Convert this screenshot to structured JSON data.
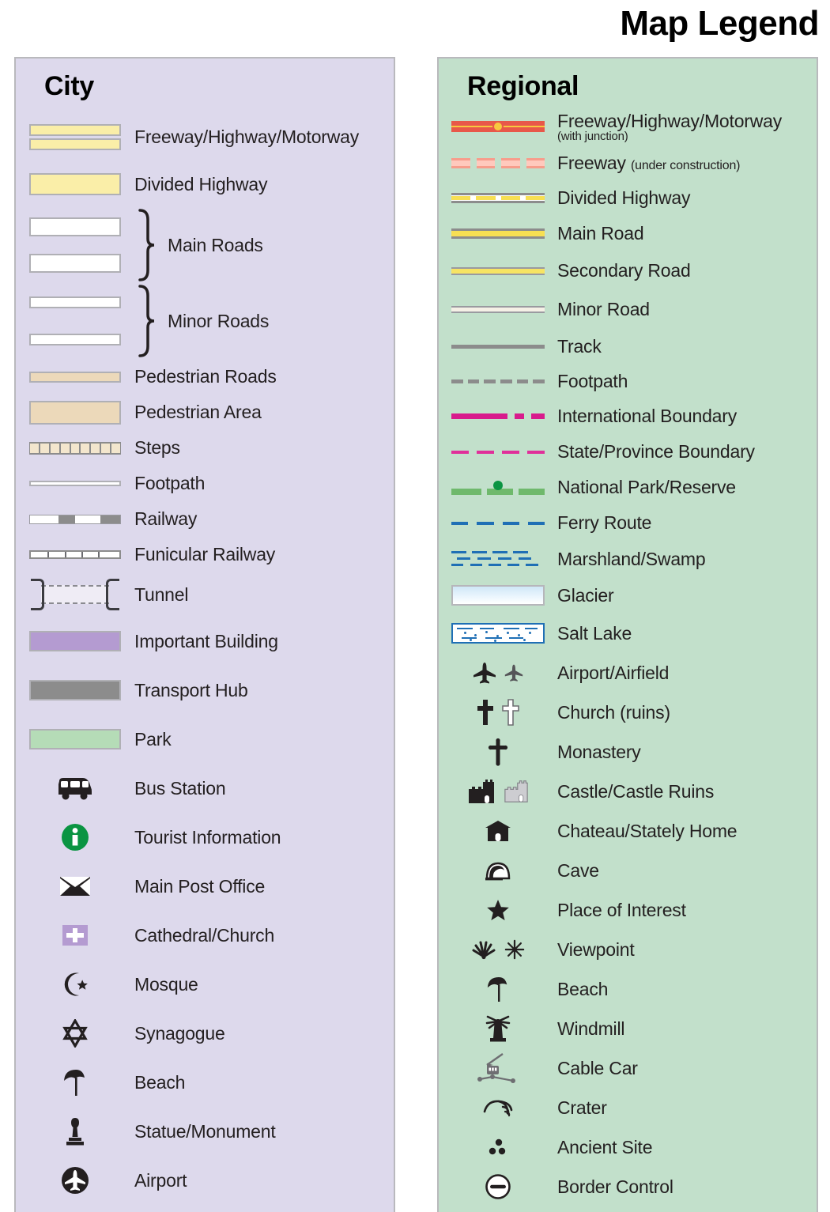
{
  "title": "Map Legend",
  "panels": {
    "city": {
      "heading": "City",
      "background_color": "#ddd9ec",
      "items": [
        {
          "label": "Freeway/Highway/Motorway",
          "symbol": "city-freeway-swatch"
        },
        {
          "label": "Divided Highway",
          "symbol": "city-divided-highway-swatch"
        },
        {
          "label": "Main Roads",
          "symbol": "city-main-roads-swatch"
        },
        {
          "label": "Minor Roads",
          "symbol": "city-minor-roads-swatch"
        },
        {
          "label": "Pedestrian Roads",
          "symbol": "city-pedestrian-road-swatch"
        },
        {
          "label": "Pedestrian Area",
          "symbol": "city-pedestrian-area-swatch"
        },
        {
          "label": "Steps",
          "symbol": "city-steps-swatch"
        },
        {
          "label": "Footpath",
          "symbol": "city-footpath-swatch"
        },
        {
          "label": "Railway",
          "symbol": "city-railway-swatch"
        },
        {
          "label": "Funicular Railway",
          "symbol": "city-funicular-swatch"
        },
        {
          "label": "Tunnel",
          "symbol": "city-tunnel-swatch"
        },
        {
          "label": "Important Building",
          "symbol": "city-important-building-swatch"
        },
        {
          "label": "Transport Hub",
          "symbol": "city-transport-hub-swatch"
        },
        {
          "label": "Park",
          "symbol": "city-park-swatch"
        },
        {
          "label": "Bus Station",
          "symbol": "bus-icon"
        },
        {
          "label": "Tourist Information",
          "symbol": "information-icon"
        },
        {
          "label": "Main Post Office",
          "symbol": "envelope-icon"
        },
        {
          "label": "Cathedral/Church",
          "symbol": "church-cross-square-icon"
        },
        {
          "label": "Mosque",
          "symbol": "star-and-crescent-icon"
        },
        {
          "label": "Synagogue",
          "symbol": "star-of-david-icon"
        },
        {
          "label": "Beach",
          "symbol": "beach-umbrella-icon"
        },
        {
          "label": "Statue/Monument",
          "symbol": "statue-icon"
        },
        {
          "label": "Airport",
          "symbol": "airplane-circle-icon"
        }
      ]
    },
    "regional": {
      "heading": "Regional",
      "background_color": "#c2e0cb",
      "items": [
        {
          "label": "Freeway/Highway/Motorway",
          "sublabel": "(with junction)",
          "sublabel_style": "block",
          "symbol": "regional-freeway-junction-swatch"
        },
        {
          "label": "Freeway",
          "sublabel": "(under construction)",
          "sublabel_style": "inline",
          "symbol": "regional-freeway-construction-swatch"
        },
        {
          "label": "Divided Highway",
          "symbol": "regional-divided-highway-swatch"
        },
        {
          "label": "Main Road",
          "symbol": "regional-main-road-swatch"
        },
        {
          "label": "Secondary Road",
          "symbol": "regional-secondary-road-swatch"
        },
        {
          "label": "Minor Road",
          "symbol": "regional-minor-road-swatch"
        },
        {
          "label": "Track",
          "symbol": "regional-track-swatch"
        },
        {
          "label": "Footpath",
          "symbol": "regional-footpath-swatch"
        },
        {
          "label": "International Boundary",
          "symbol": "regional-international-boundary-swatch"
        },
        {
          "label": "State/Province Boundary",
          "symbol": "regional-state-boundary-swatch"
        },
        {
          "label": "National Park/Reserve",
          "symbol": "regional-national-park-swatch"
        },
        {
          "label": "Ferry Route",
          "symbol": "regional-ferry-route-swatch"
        },
        {
          "label": "Marshland/Swamp",
          "symbol": "regional-marshland-swatch"
        },
        {
          "label": "Glacier",
          "symbol": "regional-glacier-swatch"
        },
        {
          "label": "Salt Lake",
          "symbol": "regional-salt-lake-swatch"
        },
        {
          "label": "Airport/Airfield",
          "symbol": "airplane-pair-icon"
        },
        {
          "label": "Church (ruins)",
          "symbol": "cross-pair-icon"
        },
        {
          "label": "Monastery",
          "symbol": "budded-cross-icon"
        },
        {
          "label": "Castle/Castle Ruins",
          "symbol": "castle-pair-icon"
        },
        {
          "label": "Chateau/Stately Home",
          "symbol": "chateau-icon"
        },
        {
          "label": "Cave",
          "symbol": "cave-icon"
        },
        {
          "label": "Place of Interest",
          "symbol": "star-icon"
        },
        {
          "label": "Viewpoint",
          "symbol": "viewpoint-pair-icon"
        },
        {
          "label": "Beach",
          "symbol": "beach-umbrella-icon"
        },
        {
          "label": "Windmill",
          "symbol": "windmill-icon"
        },
        {
          "label": "Cable Car",
          "symbol": "cable-car-icon"
        },
        {
          "label": "Crater",
          "symbol": "crater-icon"
        },
        {
          "label": "Ancient Site",
          "symbol": "ancient-site-icon"
        },
        {
          "label": "Border Control",
          "symbol": "border-control-icon"
        }
      ]
    }
  },
  "colors": {
    "city_panel": "#ddd9ec",
    "regional_panel": "#c2e0cb",
    "highway_yellow": "#faeea8",
    "pedestrian_tan": "#ecd9ba",
    "important_building_purple": "#b49bd1",
    "transport_hub_gray": "#8c8c8c",
    "park_green": "#b5dcb7",
    "tourist_info_green": "#0a9442",
    "freeway_red": "#e8584a",
    "freeway_core_yellow": "#f7c93f",
    "boundary_magenta": "#d81b8c",
    "ferry_blue": "#1f6fb5",
    "national_park_green": "#6fb96c"
  }
}
